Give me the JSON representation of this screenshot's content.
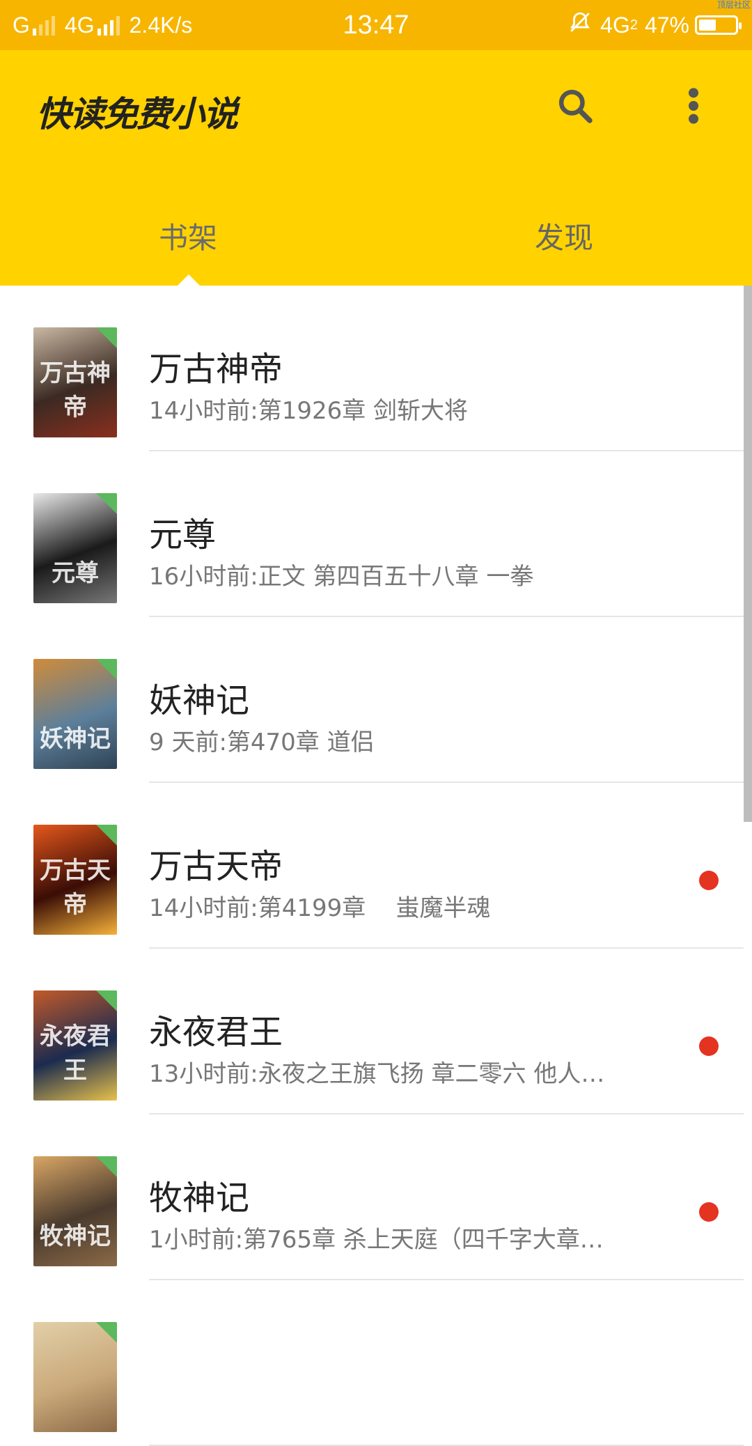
{
  "status_bar": {
    "carrier1": "G",
    "carrier2": "4G",
    "speed": "2.4K/s",
    "time": "13:47",
    "network": "4G",
    "sim": "2",
    "battery_text": "47%",
    "battery_level": 0.47,
    "watermark": "顶层社区"
  },
  "app_bar": {
    "title": "快读免费小说",
    "search_icon": "search-icon",
    "more_icon": "more-vertical-icon"
  },
  "tabs": [
    {
      "label": "书架",
      "active": true
    },
    {
      "label": "发现",
      "active": false
    }
  ],
  "books": [
    {
      "title": "万古神帝",
      "update": "14小时前:第1926章 剑斩大将",
      "unread": false,
      "cover_text": "万古神帝",
      "cover_colors": [
        "#3b2a22",
        "#c9b8a3",
        "#8a2f1e"
      ]
    },
    {
      "title": "元尊",
      "update": "16小时前:正文 第四百五十八章 一拳",
      "unread": false,
      "cover_text": "元尊",
      "cover_colors": [
        "#1a1a1a",
        "#e8e8e8",
        "#777777"
      ]
    },
    {
      "title": "妖神记",
      "update": "9 天前:第470章 道侣",
      "unread": false,
      "cover_text": "妖神记",
      "cover_colors": [
        "#5d7f9a",
        "#d08b3a",
        "#2f4355"
      ]
    },
    {
      "title": "万古天帝",
      "update": "14小时前:第4199章    蚩魔半魂",
      "unread": true,
      "cover_text": "万古天帝",
      "cover_colors": [
        "#3a0d06",
        "#e4571c",
        "#f6b23a"
      ]
    },
    {
      "title": "永夜君王",
      "update": "13小时前:永夜之王旗飞扬 章二零六 他人…",
      "unread": true,
      "cover_text": "永夜君王",
      "cover_colors": [
        "#1b2b4f",
        "#c25a2a",
        "#e8c14c"
      ]
    },
    {
      "title": "牧神记",
      "update": "1小时前:第765章 杀上天庭（四千字大章…",
      "unread": true,
      "cover_text": "牧神记",
      "cover_colors": [
        "#4a3b2e",
        "#d9a665",
        "#8c6a47"
      ]
    },
    {
      "title": "",
      "update": "",
      "unread": false,
      "cover_text": "",
      "cover_colors": [
        "#c9a97a",
        "#e2cfa8",
        "#8c6a47"
      ]
    }
  ]
}
